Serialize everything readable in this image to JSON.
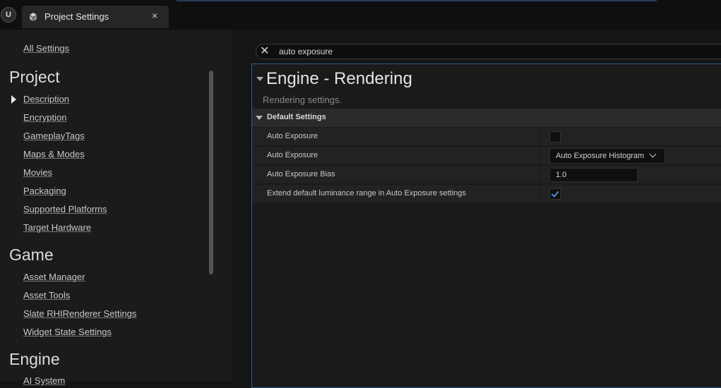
{
  "window": {
    "tab_title": "Project Settings",
    "tab_close_glyph": "×",
    "app_logo_text": "U"
  },
  "sidebar": {
    "all_settings": "All Settings",
    "sections": [
      {
        "title": "Project",
        "items": [
          "Description",
          "Encryption",
          "GameplayTags",
          "Maps & Modes",
          "Movies",
          "Packaging",
          "Supported Platforms",
          "Target Hardware"
        ]
      },
      {
        "title": "Game",
        "items": [
          "Asset Manager",
          "Asset Tools",
          "Slate RHIRenderer Settings",
          "Widget State Settings"
        ]
      },
      {
        "title": "Engine",
        "items": [
          "AI System"
        ]
      }
    ]
  },
  "search": {
    "value": "auto exposure",
    "clear_glyph": "✕"
  },
  "panel": {
    "title": "Engine - Rendering",
    "description": "Rendering settings.",
    "category": "Default Settings",
    "rows": [
      {
        "name": "Auto Exposure",
        "type": "checkbox",
        "checked": false
      },
      {
        "name": "Auto Exposure",
        "type": "select",
        "value": "Auto Exposure Histogram"
      },
      {
        "name": "Auto Exposure Bias",
        "type": "number",
        "value": "1.0"
      },
      {
        "name": "Extend default luminance range in Auto Exposure settings",
        "type": "checkbox",
        "checked": true
      }
    ]
  },
  "colors": {
    "accent": "#2d5b8c",
    "check": "#4a8ed6",
    "background": "#151515"
  },
  "icons": {
    "app_logo": "unreal-logo-icon",
    "tab": "project-settings-icon",
    "expand_arrow": "triangle-right-icon",
    "collapse_arrow": "triangle-down-icon"
  }
}
